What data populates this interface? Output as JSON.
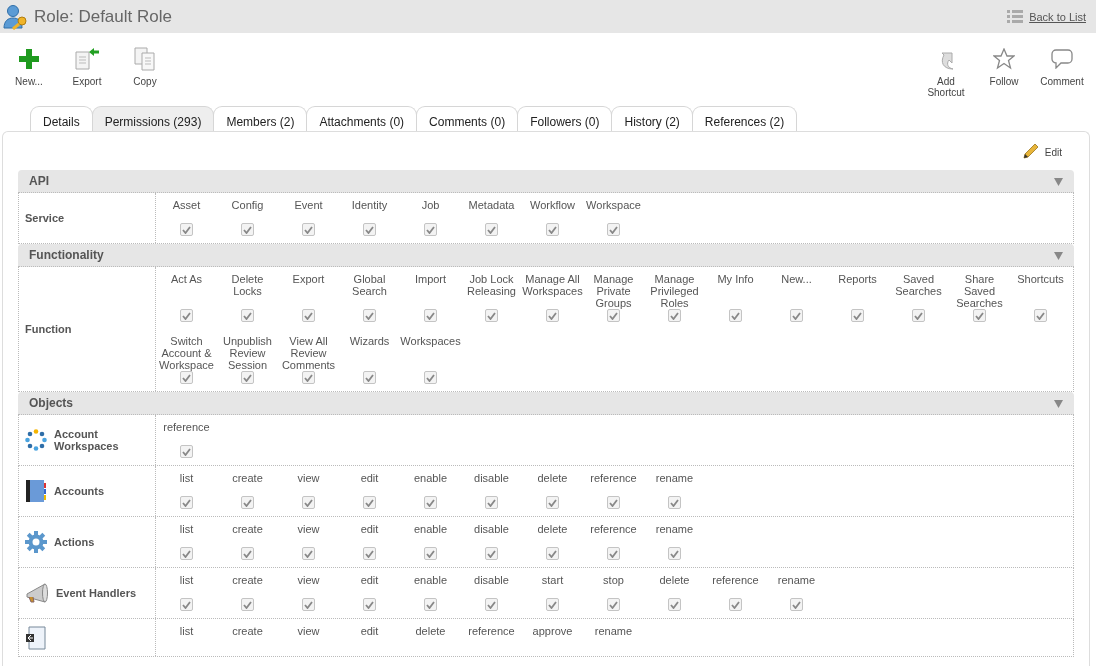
{
  "header": {
    "title": "Role: Default Role",
    "back_link": "Back to List"
  },
  "toolbar": {
    "left": [
      {
        "label": "New...",
        "kind": "new"
      },
      {
        "label": "Export",
        "kind": "export"
      },
      {
        "label": "Copy",
        "kind": "copy"
      }
    ],
    "right": [
      {
        "label": "Add Shortcut",
        "kind": "shortcut"
      },
      {
        "label": "Follow",
        "kind": "follow"
      },
      {
        "label": "Comment",
        "kind": "comment"
      }
    ]
  },
  "tabs": [
    {
      "label": "Details",
      "selected": false
    },
    {
      "label": "Permissions (293)",
      "selected": true
    },
    {
      "label": "Members (2)",
      "selected": false
    },
    {
      "label": "Attachments (0)",
      "selected": false
    },
    {
      "label": "Comments (0)",
      "selected": false
    },
    {
      "label": "Followers (0)",
      "selected": false
    },
    {
      "label": "History (2)",
      "selected": false
    },
    {
      "label": "References (2)",
      "selected": false
    }
  ],
  "edit_link": "Edit",
  "sections": [
    {
      "title": "API",
      "expanded": true,
      "rows": [
        {
          "label": "Service",
          "kind": "plain",
          "permissions": [
            {
              "label": "Asset",
              "checked": true
            },
            {
              "label": "Config",
              "checked": true
            },
            {
              "label": "Event",
              "checked": true
            },
            {
              "label": "Identity",
              "checked": true
            },
            {
              "label": "Job",
              "checked": true
            },
            {
              "label": "Metadata",
              "checked": true
            },
            {
              "label": "Workflow",
              "checked": true
            },
            {
              "label": "Workspace",
              "checked": true
            }
          ]
        }
      ]
    },
    {
      "title": "Functionality",
      "expanded": true,
      "rows": [
        {
          "label": "Function",
          "kind": "plain",
          "permissions": [
            {
              "label": "Act As",
              "checked": true
            },
            {
              "label": "Delete Locks",
              "checked": true
            },
            {
              "label": "Export",
              "checked": true
            },
            {
              "label": "Global Search",
              "checked": true
            },
            {
              "label": "Import",
              "checked": true
            },
            {
              "label": "Job Lock Releasing",
              "checked": true
            },
            {
              "label": "Manage All Workspaces",
              "checked": true
            },
            {
              "label": "Manage Private Groups",
              "checked": true
            },
            {
              "label": "Manage Privileged Roles",
              "checked": true
            },
            {
              "label": "My Info",
              "checked": true
            },
            {
              "label": "New...",
              "checked": true
            },
            {
              "label": "Reports",
              "checked": true
            },
            {
              "label": "Saved Searches",
              "checked": true
            },
            {
              "label": "Share Saved Searches",
              "checked": true
            },
            {
              "label": "Shortcuts",
              "checked": true
            },
            {
              "label": "Switch Account & Workspace",
              "checked": true
            },
            {
              "label": "Unpublish Review Session",
              "checked": true
            },
            {
              "label": "View All Review Comments",
              "checked": true
            },
            {
              "label": "Wizards",
              "checked": true
            },
            {
              "label": "Workspaces",
              "checked": true
            }
          ]
        }
      ]
    },
    {
      "title": "Objects",
      "expanded": true,
      "rows": [
        {
          "label": "Account Workspaces",
          "kind": "dots",
          "permissions": [
            {
              "label": "reference",
              "checked": true
            }
          ]
        },
        {
          "label": "Accounts",
          "kind": "book",
          "permissions": [
            {
              "label": "list",
              "checked": true
            },
            {
              "label": "create",
              "checked": true
            },
            {
              "label": "view",
              "checked": true
            },
            {
              "label": "edit",
              "checked": true
            },
            {
              "label": "enable",
              "checked": true
            },
            {
              "label": "disable",
              "checked": true
            },
            {
              "label": "delete",
              "checked": true
            },
            {
              "label": "reference",
              "checked": true
            },
            {
              "label": "rename",
              "checked": true
            }
          ]
        },
        {
          "label": "Actions",
          "kind": "gear",
          "permissions": [
            {
              "label": "list",
              "checked": true
            },
            {
              "label": "create",
              "checked": true
            },
            {
              "label": "view",
              "checked": true
            },
            {
              "label": "edit",
              "checked": true
            },
            {
              "label": "enable",
              "checked": true
            },
            {
              "label": "disable",
              "checked": true
            },
            {
              "label": "delete",
              "checked": true
            },
            {
              "label": "reference",
              "checked": true
            },
            {
              "label": "rename",
              "checked": true
            }
          ]
        },
        {
          "label": "Event Handlers",
          "kind": "megaphone",
          "permissions": [
            {
              "label": "list",
              "checked": true
            },
            {
              "label": "create",
              "checked": true
            },
            {
              "label": "view",
              "checked": true
            },
            {
              "label": "edit",
              "checked": true
            },
            {
              "label": "enable",
              "checked": true
            },
            {
              "label": "disable",
              "checked": true
            },
            {
              "label": "start",
              "checked": true
            },
            {
              "label": "stop",
              "checked": true
            },
            {
              "label": "delete",
              "checked": true
            },
            {
              "label": "reference",
              "checked": true
            },
            {
              "label": "rename",
              "checked": true
            }
          ]
        },
        {
          "kind": "document",
          "permissions": [
            {
              "label": "list"
            },
            {
              "label": "create"
            },
            {
              "label": "view"
            },
            {
              "label": "edit"
            },
            {
              "label": "delete"
            },
            {
              "label": "reference"
            },
            {
              "label": "approve"
            },
            {
              "label": "rename"
            }
          ]
        }
      ]
    }
  ]
}
